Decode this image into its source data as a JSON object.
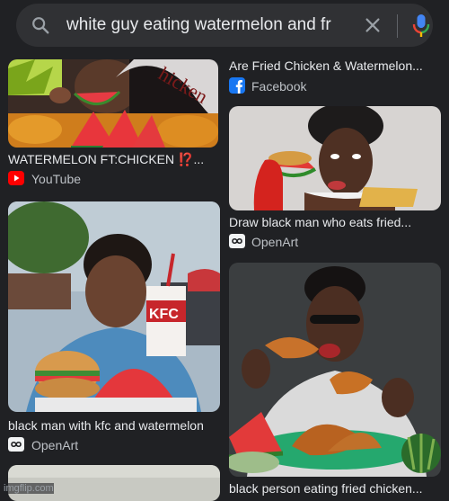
{
  "search": {
    "query": "white guy eating watermelon and fr",
    "icon": "search-icon",
    "clear_icon": "close-icon",
    "mic_icon": "mic-icon"
  },
  "results": [
    {
      "title": "WATERMELON FT:CHICKEN ⁉️...",
      "source": "YouTube",
      "source_icon": "youtube-icon",
      "image_text": "hicken"
    },
    {
      "title": "Are Fried Chicken & Watermelon...",
      "source": "Facebook",
      "source_icon": "facebook-icon"
    },
    {
      "title": "Draw black man who eats fried...",
      "source": "OpenArt",
      "source_icon": "openart-icon"
    },
    {
      "title": "black man with kfc and watermelon",
      "source": "OpenArt",
      "source_icon": "openart-icon",
      "image_text": "KFC"
    },
    {
      "title": "black person eating fried chicken...",
      "source": "",
      "source_icon": ""
    }
  ],
  "watermark": "imgflip.com",
  "colors": {
    "background": "#202124",
    "searchbar": "#303134",
    "youtube": "#ff0000",
    "facebook": "#1877f2"
  }
}
